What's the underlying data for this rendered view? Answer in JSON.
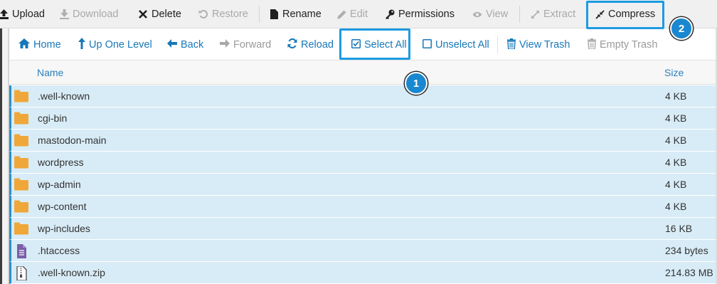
{
  "toolbar": {
    "upload": "Upload",
    "download": "Download",
    "delete": "Delete",
    "restore": "Restore",
    "rename": "Rename",
    "edit": "Edit",
    "permissions": "Permissions",
    "view": "View",
    "extract": "Extract",
    "compress": "Compress"
  },
  "nav": {
    "home": "Home",
    "up_one_level": "Up One Level",
    "back": "Back",
    "forward": "Forward",
    "reload": "Reload",
    "select_all": "Select All",
    "unselect_all": "Unselect All",
    "view_trash": "View Trash",
    "empty_trash": "Empty Trash"
  },
  "table": {
    "columns": [
      "Name",
      "Size"
    ],
    "rows": [
      {
        "name": ".well-known",
        "size": "4 KB",
        "icon": "folder-icon"
      },
      {
        "name": "cgi-bin",
        "size": "4 KB",
        "icon": "folder-icon"
      },
      {
        "name": "mastodon-main",
        "size": "4 KB",
        "icon": "folder-icon"
      },
      {
        "name": "wordpress",
        "size": "4 KB",
        "icon": "folder-icon"
      },
      {
        "name": "wp-admin",
        "size": "4 KB",
        "icon": "folder-icon"
      },
      {
        "name": "wp-content",
        "size": "4 KB",
        "icon": "folder-icon"
      },
      {
        "name": "wp-includes",
        "size": "16 KB",
        "icon": "folder-icon"
      },
      {
        "name": ".htaccess",
        "size": "234 bytes",
        "icon": "text-file-icon"
      },
      {
        "name": ".well-known.zip",
        "size": "214.83 MB",
        "icon": "zip-file-icon"
      }
    ]
  },
  "annotations": {
    "badge1": "1",
    "badge2": "2"
  },
  "colors": {
    "accent": "#1878b8",
    "highlight": "#1d9be2",
    "row_selected": "#d8ecf7",
    "folder": "#f0a73a",
    "text_file": "#7a5ea8"
  }
}
